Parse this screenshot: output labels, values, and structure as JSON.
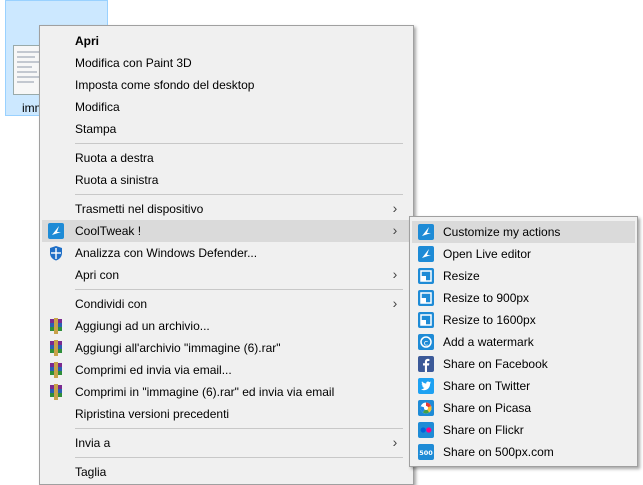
{
  "desktop": {
    "file_label": "imm"
  },
  "context_menu": {
    "items": [
      {
        "label": "Apri",
        "bold": true
      },
      {
        "label": "Modifica con Paint 3D"
      },
      {
        "label": "Imposta come sfondo del desktop"
      },
      {
        "label": "Modifica"
      },
      {
        "label": "Stampa"
      },
      {
        "label": "Ruota a destra"
      },
      {
        "label": "Ruota a sinistra"
      },
      {
        "label": "Trasmetti nel dispositivo",
        "submenu": true
      },
      {
        "label": "CoolTweak !",
        "submenu": true,
        "icon": "cooltweak-icon",
        "highlighted": true
      },
      {
        "label": "Analizza con Windows Defender...",
        "icon": "windows-defender-icon"
      },
      {
        "label": "Apri con",
        "submenu": true
      },
      {
        "label": "Condividi con",
        "submenu": true
      },
      {
        "label": "Aggiungi ad un archivio...",
        "icon": "winrar-icon"
      },
      {
        "label": "Aggiungi all'archivio \"immagine (6).rar\"",
        "icon": "winrar-icon"
      },
      {
        "label": "Comprimi ed invia via email...",
        "icon": "winrar-icon"
      },
      {
        "label": "Comprimi in \"immagine (6).rar\" ed invia via email",
        "icon": "winrar-icon"
      },
      {
        "label": "Ripristina versioni precedenti"
      },
      {
        "label": "Invia a",
        "submenu": true
      },
      {
        "label": "Taglia"
      }
    ]
  },
  "cooltweak_submenu": {
    "items": [
      {
        "label": "Customize my actions",
        "icon": "cooltweak-icon",
        "highlighted": true
      },
      {
        "label": "Open Live editor",
        "icon": "cooltweak-icon"
      },
      {
        "label": "Resize",
        "icon": "resize-icon"
      },
      {
        "label": "Resize to 900px",
        "icon": "resize-icon"
      },
      {
        "label": "Resize to 1600px",
        "icon": "resize-icon"
      },
      {
        "label": "Add a watermark",
        "icon": "watermark-icon"
      },
      {
        "label": "Share on Facebook",
        "icon": "facebook-icon"
      },
      {
        "label": "Share on Twitter",
        "icon": "twitter-icon"
      },
      {
        "label": "Share on Picasa",
        "icon": "picasa-icon"
      },
      {
        "label": "Share on Flickr",
        "icon": "flickr-icon"
      },
      {
        "label": "Share on 500px.com",
        "icon": "500px-icon"
      }
    ]
  },
  "colors": {
    "menu_bg": "#f0f0f0",
    "highlight": "#dadada",
    "selection": "#cce8ff",
    "cooltweak_blue": "#1e8bd6",
    "facebook": "#3b5998",
    "twitter": "#1da1f2"
  }
}
